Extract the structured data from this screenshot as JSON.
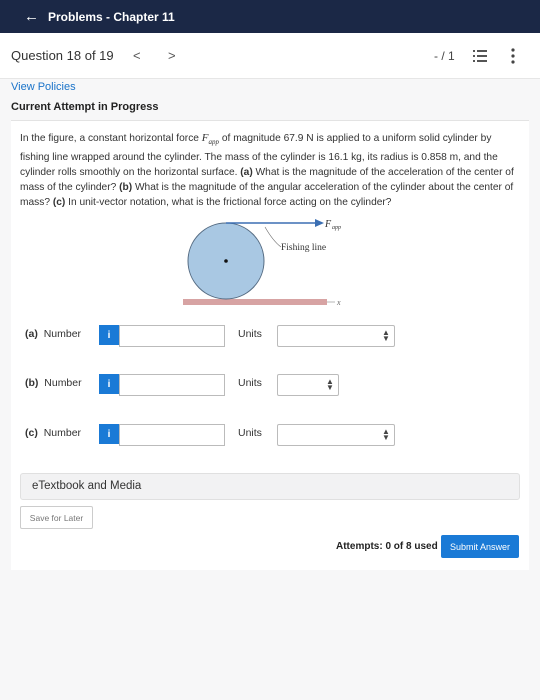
{
  "header": {
    "back_icon": "arrow-left-icon",
    "title": "Problems - Chapter 11"
  },
  "question_bar": {
    "label": "Question 18 of 19",
    "prev": "<",
    "next": ">",
    "score": "- / 1",
    "list_icon": "list-icon",
    "menu_icon": "kebab-menu-icon"
  },
  "links": {
    "view_policies": "View Policies"
  },
  "status": {
    "current_attempt": "Current Attempt in Progress"
  },
  "problem": {
    "intro": "In the figure, a constant horizontal force ",
    "force_symbol": "F",
    "force_sub": "app",
    "text1": " of magnitude 67.9 N is applied to a uniform solid cylinder by fishing line wrapped around the cylinder. The mass of the cylinder is 16.1 kg, its radius is 0.858 m, and the cylinder rolls smoothly on the horizontal surface. ",
    "a_label": "(a)",
    "a_text": " What is the magnitude of the acceleration of the center of mass of the cylinder? ",
    "b_label": "(b)",
    "b_text": " What is the magnitude of the angular acceleration of the cylinder about the center of mass? ",
    "c_label": "(c)",
    "c_text": " In unit-vector notation, what is the frictional force acting on the cylinder?"
  },
  "figure": {
    "force_label": "F",
    "force_sub": "app",
    "line_label": "Fishing line",
    "axis_label": "x"
  },
  "answers": [
    {
      "part": "(a)",
      "label": "Number",
      "info": "i",
      "value": "",
      "units_label": "Units",
      "unit_value": ""
    },
    {
      "part": "(b)",
      "label": "Number",
      "info": "i",
      "value": "",
      "units_label": "Units",
      "unit_value": ""
    },
    {
      "part": "(c)",
      "label": "Number",
      "info": "i",
      "value": "",
      "units_label": "Units",
      "unit_value": ""
    }
  ],
  "etextbook": "eTextbook and Media",
  "save_label": "Save for Later",
  "attempts_text": "Attempts: 0 of 8 used",
  "submit_label": "Submit Answer",
  "colors": {
    "header_bg": "#1b2846",
    "accent": "#1a7ad6",
    "cylinder": "#a9c8e3",
    "ground": "#d7a3a3"
  }
}
